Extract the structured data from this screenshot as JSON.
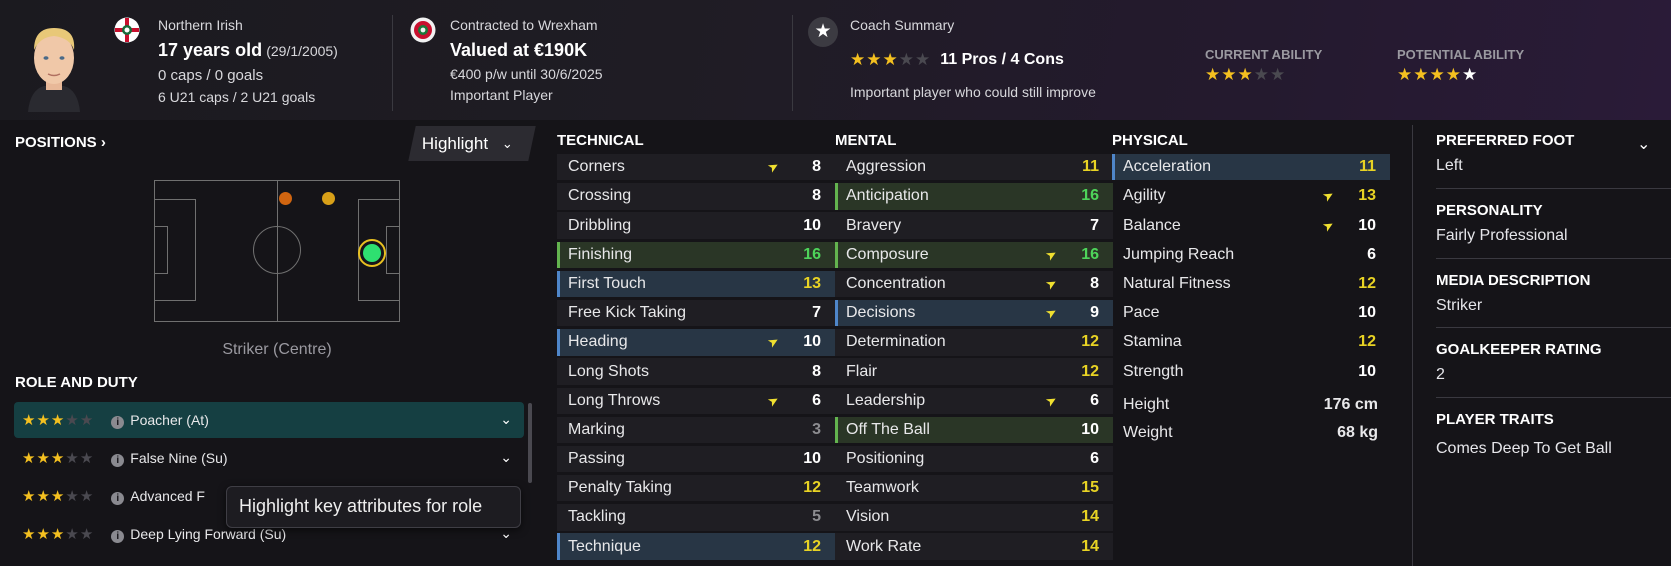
{
  "header": {
    "nationality": "Northern Irish",
    "age": "17 years old",
    "dob": "(29/1/2005)",
    "caps": "0 caps / 0 goals",
    "u21": "6 U21 caps / 2 U21 goals",
    "contract": "Contracted to Wrexham",
    "value": "Valued at €190K",
    "wage": "€400 p/w until 30/6/2025",
    "status": "Important Player",
    "coach_title": "Coach Summary",
    "coach_pros_cons": "11 Pros / 4 Cons",
    "coach_stars": 3,
    "coach_text": "Important player who could still improve",
    "ca_label": "CURRENT ABILITY",
    "ca_stars": 3,
    "pa_label": "POTENTIAL ABILITY",
    "pa_stars": 4.5
  },
  "positions": {
    "title": "POSITIONS",
    "highlight_label": "Highlight",
    "position_label": "Striker (Centre)"
  },
  "roles": {
    "title": "ROLE AND DUTY",
    "items": [
      {
        "name": "Poacher (At)",
        "stars": 3
      },
      {
        "name": "False Nine (Su)",
        "stars": 3
      },
      {
        "name": "Advanced F",
        "stars": 3
      },
      {
        "name": "Deep Lying Forward (Su)",
        "stars": 3
      }
    ],
    "tooltip": "Highlight key attributes for role"
  },
  "technical": {
    "title": "TECHNICAL",
    "items": [
      {
        "name": "Corners",
        "value": "8",
        "color": "white",
        "hl": "",
        "arrow": true
      },
      {
        "name": "Crossing",
        "value": "8",
        "color": "white",
        "hl": "",
        "arrow": false
      },
      {
        "name": "Dribbling",
        "value": "10",
        "color": "white",
        "hl": "",
        "arrow": false
      },
      {
        "name": "Finishing",
        "value": "16",
        "color": "green",
        "hl": "g",
        "arrow": false
      },
      {
        "name": "First Touch",
        "value": "13",
        "color": "yellow",
        "hl": "b",
        "arrow": false
      },
      {
        "name": "Free Kick Taking",
        "value": "7",
        "color": "white",
        "hl": "",
        "arrow": false
      },
      {
        "name": "Heading",
        "value": "10",
        "color": "white",
        "hl": "b",
        "arrow": true
      },
      {
        "name": "Long Shots",
        "value": "8",
        "color": "white",
        "hl": "",
        "arrow": false
      },
      {
        "name": "Long Throws",
        "value": "6",
        "color": "white",
        "hl": "",
        "arrow": true
      },
      {
        "name": "Marking",
        "value": "3",
        "color": "grey",
        "hl": "",
        "arrow": false
      },
      {
        "name": "Passing",
        "value": "10",
        "color": "white",
        "hl": "",
        "arrow": false
      },
      {
        "name": "Penalty Taking",
        "value": "12",
        "color": "yellow",
        "hl": "",
        "arrow": false
      },
      {
        "name": "Tackling",
        "value": "5",
        "color": "grey",
        "hl": "",
        "arrow": false
      },
      {
        "name": "Technique",
        "value": "12",
        "color": "yellow",
        "hl": "b",
        "arrow": false
      }
    ]
  },
  "mental": {
    "title": "MENTAL",
    "items": [
      {
        "name": "Aggression",
        "value": "11",
        "color": "yellow",
        "hl": "",
        "arrow": false
      },
      {
        "name": "Anticipation",
        "value": "16",
        "color": "green",
        "hl": "g",
        "arrow": false
      },
      {
        "name": "Bravery",
        "value": "7",
        "color": "white",
        "hl": "",
        "arrow": false
      },
      {
        "name": "Composure",
        "value": "16",
        "color": "green",
        "hl": "g",
        "arrow": true
      },
      {
        "name": "Concentration",
        "value": "8",
        "color": "white",
        "hl": "",
        "arrow": true
      },
      {
        "name": "Decisions",
        "value": "9",
        "color": "white",
        "hl": "b",
        "arrow": true
      },
      {
        "name": "Determination",
        "value": "12",
        "color": "yellow",
        "hl": "",
        "arrow": false
      },
      {
        "name": "Flair",
        "value": "12",
        "color": "yellow",
        "hl": "",
        "arrow": false
      },
      {
        "name": "Leadership",
        "value": "6",
        "color": "white",
        "hl": "",
        "arrow": true
      },
      {
        "name": "Off The Ball",
        "value": "10",
        "color": "white",
        "hl": "g",
        "arrow": false
      },
      {
        "name": "Positioning",
        "value": "6",
        "color": "white",
        "hl": "",
        "arrow": false
      },
      {
        "name": "Teamwork",
        "value": "15",
        "color": "yellow",
        "hl": "",
        "arrow": false
      },
      {
        "name": "Vision",
        "value": "14",
        "color": "yellow",
        "hl": "",
        "arrow": false
      },
      {
        "name": "Work Rate",
        "value": "14",
        "color": "yellow",
        "hl": "",
        "arrow": false
      }
    ]
  },
  "physical": {
    "title": "PHYSICAL",
    "items": [
      {
        "name": "Acceleration",
        "value": "11",
        "color": "yellow",
        "hl": "b",
        "arrow": false
      },
      {
        "name": "Agility",
        "value": "13",
        "color": "yellow",
        "hl": "",
        "arrow": true
      },
      {
        "name": "Balance",
        "value": "10",
        "color": "white",
        "hl": "",
        "arrow": true
      },
      {
        "name": "Jumping Reach",
        "value": "6",
        "color": "white",
        "hl": "",
        "arrow": false
      },
      {
        "name": "Natural Fitness",
        "value": "12",
        "color": "yellow",
        "hl": "",
        "arrow": false
      },
      {
        "name": "Pace",
        "value": "10",
        "color": "white",
        "hl": "",
        "arrow": false
      },
      {
        "name": "Stamina",
        "value": "12",
        "color": "yellow",
        "hl": "",
        "arrow": false
      },
      {
        "name": "Strength",
        "value": "10",
        "color": "white",
        "hl": "",
        "arrow": false
      }
    ],
    "height_label": "Height",
    "height": "176 cm",
    "weight_label": "Weight",
    "weight": "68 kg"
  },
  "info": {
    "foot_title": "PREFERRED FOOT",
    "foot": "Left",
    "personality_title": "PERSONALITY",
    "personality": "Fairly Professional",
    "media_title": "MEDIA DESCRIPTION",
    "media": "Striker",
    "gk_title": "GOALKEEPER RATING",
    "gk": "2",
    "traits_title": "PLAYER TRAITS",
    "traits": "Comes Deep To Get Ball"
  },
  "colors": {
    "white": "#ffffff",
    "yellow": "#e8d324",
    "green": "#4ed45a",
    "grey": "#8c8c90",
    "accent_teal": "#153f42"
  }
}
